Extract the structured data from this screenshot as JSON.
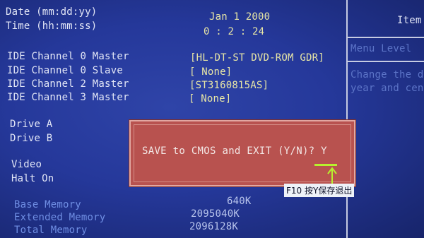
{
  "colors": {
    "background": "#25389a",
    "label": "#e2e6f6",
    "value": "#e8e6a6",
    "dialog": "#b8524f",
    "cursor": "#b7f02e"
  },
  "date_time": [
    {
      "label": "Date (mm:dd:yy)",
      "value": "Jan 1 2000"
    },
    {
      "label": "Time (hh:mm:ss)",
      "value": "0 : 2 : 24"
    }
  ],
  "ide": [
    {
      "label": "IDE Channel 0 Master",
      "value": "[HL-DT-ST DVD-ROM GDR]"
    },
    {
      "label": "IDE Channel 0 Slave",
      "value": "[ None]"
    },
    {
      "label": "IDE Channel 2 Master",
      "value": "[ST3160815AS]"
    },
    {
      "label": "IDE Channel 3 Master",
      "value": "[ None]"
    }
  ],
  "drives": [
    {
      "label": "Drive A"
    },
    {
      "label": "Drive B"
    }
  ],
  "misc": [
    {
      "label": "Video"
    },
    {
      "label": "Halt On"
    }
  ],
  "memory": [
    {
      "label": "Base Memory",
      "value": "640K"
    },
    {
      "label": "Extended Memory",
      "value": "2095040K"
    },
    {
      "label": "Total Memory",
      "value": "2096128K"
    }
  ],
  "help_panel": {
    "title": "Item",
    "menu_level": "Menu Level",
    "help_line1": "Change the d",
    "help_line2": "year and cen"
  },
  "dialog": {
    "prompt": "SAVE to CMOS and EXIT (Y/N)? Y"
  },
  "annotation": {
    "text": "F10 按Y保存退出"
  }
}
